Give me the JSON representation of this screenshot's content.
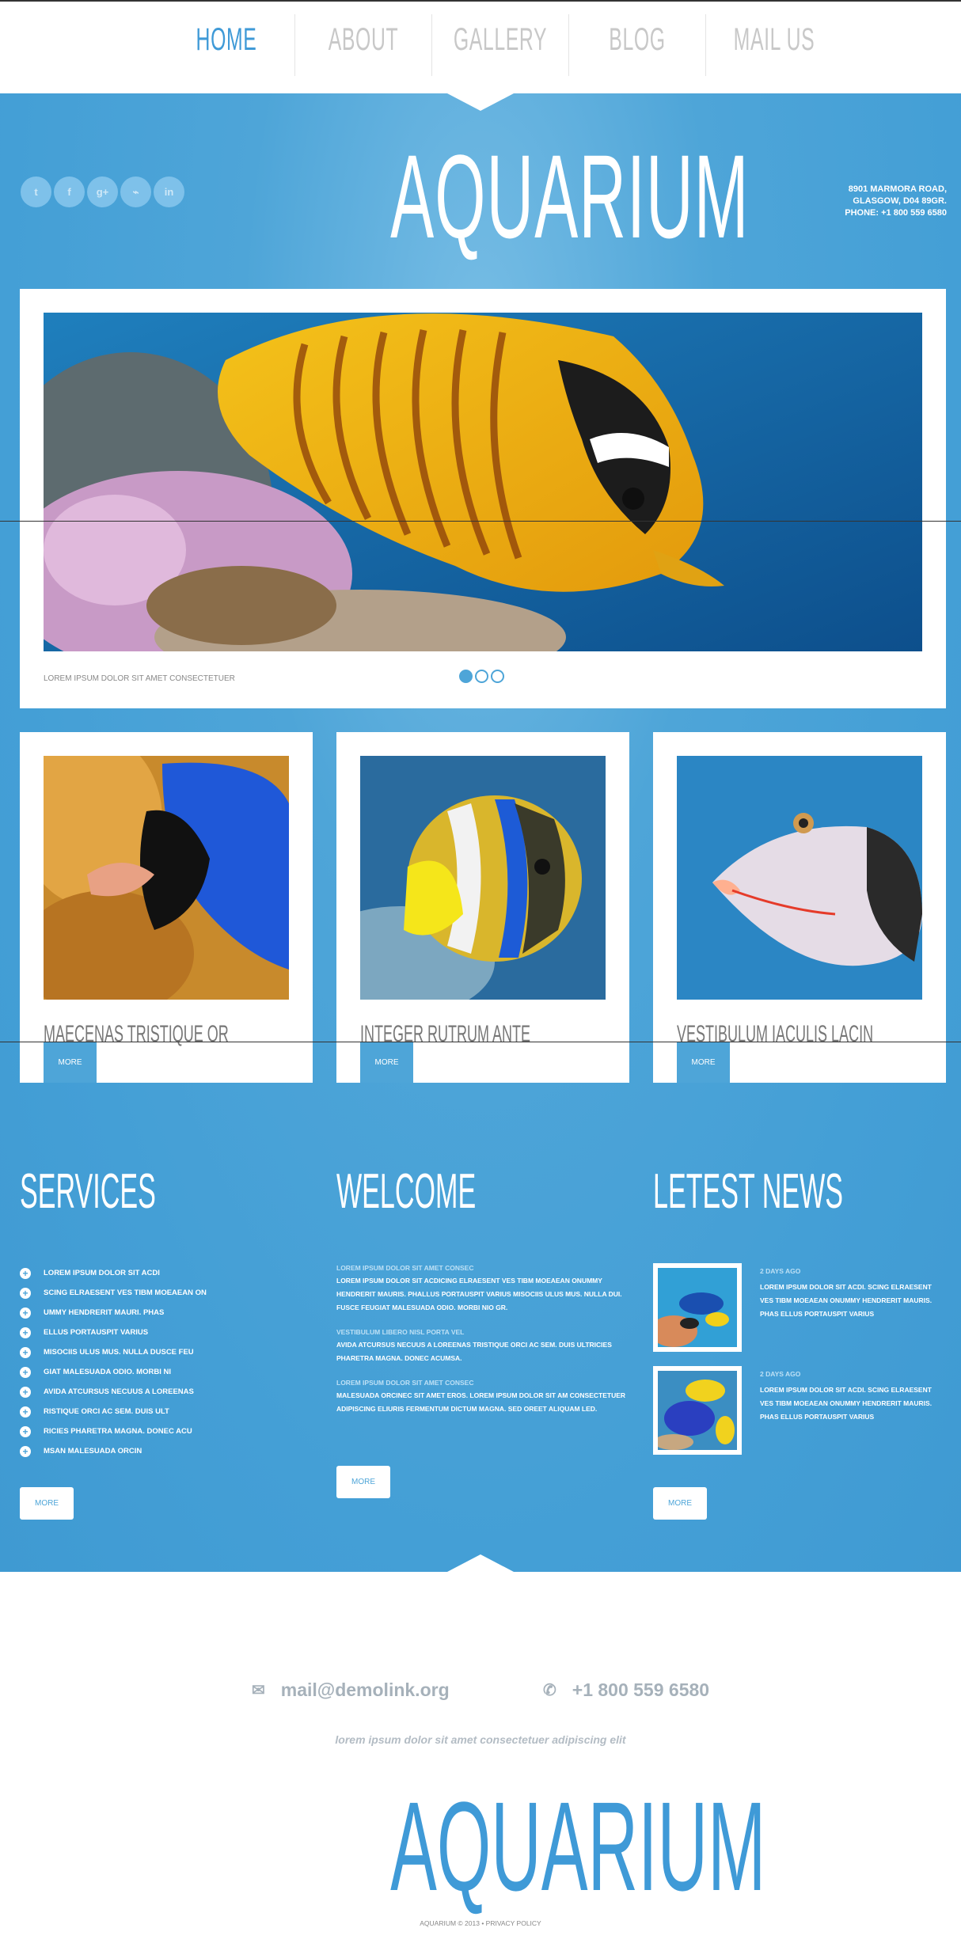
{
  "nav": {
    "items": [
      {
        "label": "HOME",
        "active": true
      },
      {
        "label": "ABOUT",
        "active": false
      },
      {
        "label": "GALLERY",
        "active": false
      },
      {
        "label": "BLOG",
        "active": false
      },
      {
        "label": "MAIL US",
        "active": false
      }
    ]
  },
  "header": {
    "logo": "AQUARIUM",
    "social": [
      "twitter-icon",
      "facebook-icon",
      "google-plus-icon",
      "rss-icon",
      "linkedin-icon"
    ],
    "social_glyphs": [
      "t",
      "f",
      "g+",
      "⌁",
      "in"
    ],
    "address_line1": "8901 MARMORA ROAD,",
    "address_line2": "GLASGOW, D04 89GR.",
    "phone": "PHONE: +1 800 559 6580"
  },
  "slider": {
    "caption": "LOREM IPSUM DOLOR SIT AMET CONSECTETUER",
    "slides_count": 3,
    "active_slide": 1
  },
  "cards": [
    {
      "title": "MAECENAS TRISTIQUE OR",
      "more": "MORE"
    },
    {
      "title": "INTEGER RUTRUM ANTE",
      "more": "MORE"
    },
    {
      "title": "VESTIBULUM IACULIS LACIN",
      "more": "MORE"
    }
  ],
  "services": {
    "title": "SERVICES",
    "items": [
      "LOREM IPSUM DOLOR SIT ACDI",
      "SCING ELRAESENT VES TIBM MOEAEAN ON",
      "UMMY HENDRERIT MAURI. PHAS",
      "ELLUS PORTAUSPIT VARIUS",
      "MISOCIIS ULUS MUS. NULLA DUSCE FEU",
      "GIAT MALESUADA ODIO. MORBI NI",
      "AVIDA ATCURSUS NECUUS A LOREENAS",
      "RISTIQUE ORCI AC SEM. DUIS ULT",
      "RICIES PHARETRA MAGNA. DONEC ACU",
      "MSAN MALESUADA ORCIN"
    ],
    "more": "MORE"
  },
  "welcome": {
    "title": "WELCOME",
    "blocks": [
      {
        "sub": "LOREM IPSUM DOLOR SIT AMET CONSEC",
        "body": "LOREM IPSUM DOLOR SIT ACDICING ELRAESENT VES TIBM MOEAEAN ONUMMY HENDRERIT MAURIS. PHALLUS PORTAUSPIT VARIUS MISOCIIS ULUS MUS. NULLA DUI. FUSCE FEUGIAT MALESUADA ODIO. MORBI NIO GR."
      },
      {
        "sub": "VESTIBULUM LIBERO NISL PORTA VEL",
        "body": "AVIDA ATCURSUS NECUUS A LOREENAS TRISTIQUE ORCI AC SEM. DUIS ULTRICIES PHARETRA MAGNA. DONEC ACUMSA."
      },
      {
        "sub": "LOREM IPSUM DOLOR SIT AMET CONSEC",
        "body": "MALESUADA ORCINEC SIT AMET EROS. LOREM IPSUM DOLOR SIT AM CONSECTETUER ADIPISCING ELIURIS FERMENTUM DICTUM MAGNA. SED OREET ALIQUAM LED."
      }
    ],
    "more": "MORE"
  },
  "news": {
    "title": "LETEST NEWS",
    "items": [
      {
        "date": "2 DAYS AGO",
        "text": "LOREM IPSUM DOLOR SIT ACDI. SCING ELRAESENT VES TIBM MOEAEAN ONUMMY HENDRERIT MAURIS. PHAS ELLUS PORTAUSPIT VARIUS"
      },
      {
        "date": "2 DAYS AGO",
        "text": "LOREM IPSUM DOLOR SIT ACDI. SCING ELRAESENT VES TIBM MOEAEAN ONUMMY HENDRERIT MAURIS. PHAS ELLUS PORTAUSPIT VARIUS"
      }
    ],
    "more": "MORE"
  },
  "footer": {
    "email": "mail@demolink.org",
    "phone": "+1 800 559 6580",
    "tagline": "lorem ipsum dolor sit amet consectetuer adipiscing elit",
    "logo": "AQUARIUM",
    "copyright": "AQUARIUM © 2013 • PRIVACY POLICY"
  },
  "colors": {
    "accent": "#3f9ad7",
    "background_blue": "#4ea5d8"
  }
}
